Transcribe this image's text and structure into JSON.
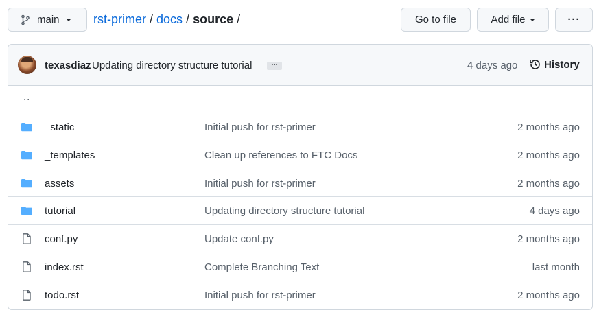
{
  "header": {
    "branch_label": "main",
    "breadcrumb": {
      "repo": "rst-primer",
      "folder": "docs",
      "current": "source",
      "separator": "/"
    },
    "goto_file_label": "Go to file",
    "add_file_label": "Add file",
    "more_label": "···"
  },
  "commit": {
    "author": "texasdiaz",
    "message": "Updating directory structure tutorial",
    "ellipsis": "…",
    "time": "4 days ago",
    "history_label": "History"
  },
  "files": {
    "up_label": "..",
    "rows": [
      {
        "icon": "folder-icon",
        "name": "_static",
        "message": "Initial push for rst-primer",
        "time": "2 months ago"
      },
      {
        "icon": "folder-icon",
        "name": "_templates",
        "message": "Clean up references to FTC Docs",
        "time": "2 months ago"
      },
      {
        "icon": "folder-icon",
        "name": "assets",
        "message": "Initial push for rst-primer",
        "time": "2 months ago"
      },
      {
        "icon": "folder-icon",
        "name": "tutorial",
        "message": "Updating directory structure tutorial",
        "time": "4 days ago"
      },
      {
        "icon": "file-icon",
        "name": "conf.py",
        "message": "Update conf.py",
        "time": "2 months ago"
      },
      {
        "icon": "file-icon",
        "name": "index.rst",
        "message": "Complete Branching Text",
        "time": "last month"
      },
      {
        "icon": "file-icon",
        "name": "todo.rst",
        "message": "Initial push for rst-primer",
        "time": "2 months ago"
      }
    ]
  },
  "colors": {
    "link": "#0969da",
    "folder": "#54aeff",
    "muted": "#57606a",
    "border": "#d0d7de"
  }
}
